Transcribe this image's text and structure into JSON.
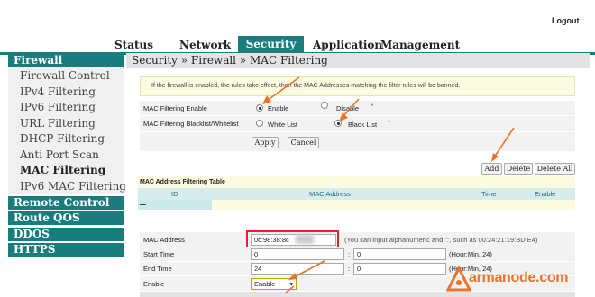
{
  "header": {
    "logout": "Logout"
  },
  "nav": {
    "tabs": [
      "Status",
      "Network",
      "Security",
      "Application",
      "Management"
    ],
    "active": "Security"
  },
  "sidebar": {
    "firewall": "Firewall",
    "items": [
      "Firewall Control",
      "IPv4 Filtering",
      "IPv6 Filtering",
      "URL Filtering",
      "DHCP Filtering",
      "Anti Port Scan",
      "MAC Filtering",
      "IPv6 MAC Filtering"
    ],
    "active_item": "MAC Filtering",
    "sections": [
      "Remote Control",
      "Route QOS",
      "DDOS",
      "HTTPS"
    ]
  },
  "breadcrumb": "Security » Firewall » MAC Filtering",
  "notice": "If the firewall is enabled, the rules take effect, then the MAC Addresses matching the filter rules will be banned.",
  "form": {
    "enable_label": "MAC Filtering Enable",
    "enable_opt": "Enable",
    "disable_opt": "Disable",
    "mode_label": "MAC Filtering Blacklist/Whitelist",
    "white_opt": "White List",
    "black_opt": "Black List",
    "apply": "Apply",
    "cancel": "Cancel",
    "required": "*"
  },
  "table_buttons": {
    "add": "Add",
    "delete": "Delete",
    "delete_all": "Delete All"
  },
  "table": {
    "title": "MAC Address Filtering Table",
    "columns": [
      "ID",
      "MAC Address",
      "Time",
      "Enable"
    ]
  },
  "entry": {
    "mac_label": "MAC Address",
    "mac_value": "0c:98:38:8c",
    "mac_hint": "(You can input alphanumeric and ':', such as 00:24:21:19:BD:E4)",
    "start_label": "Start Time",
    "start_h": "0",
    "start_m": "0",
    "end_label": "End Time",
    "end_h": "24",
    "end_m": "0",
    "colon": ":",
    "hour_hint": "(Hour:Min, 24)",
    "enable_label": "Enable",
    "enable_value": "Enable"
  },
  "watermark": {
    "text": "armanode.com"
  },
  "colors": {
    "teal": "#1a7c7c",
    "annotation": "#e8742a",
    "highlight": "#e0242c"
  }
}
